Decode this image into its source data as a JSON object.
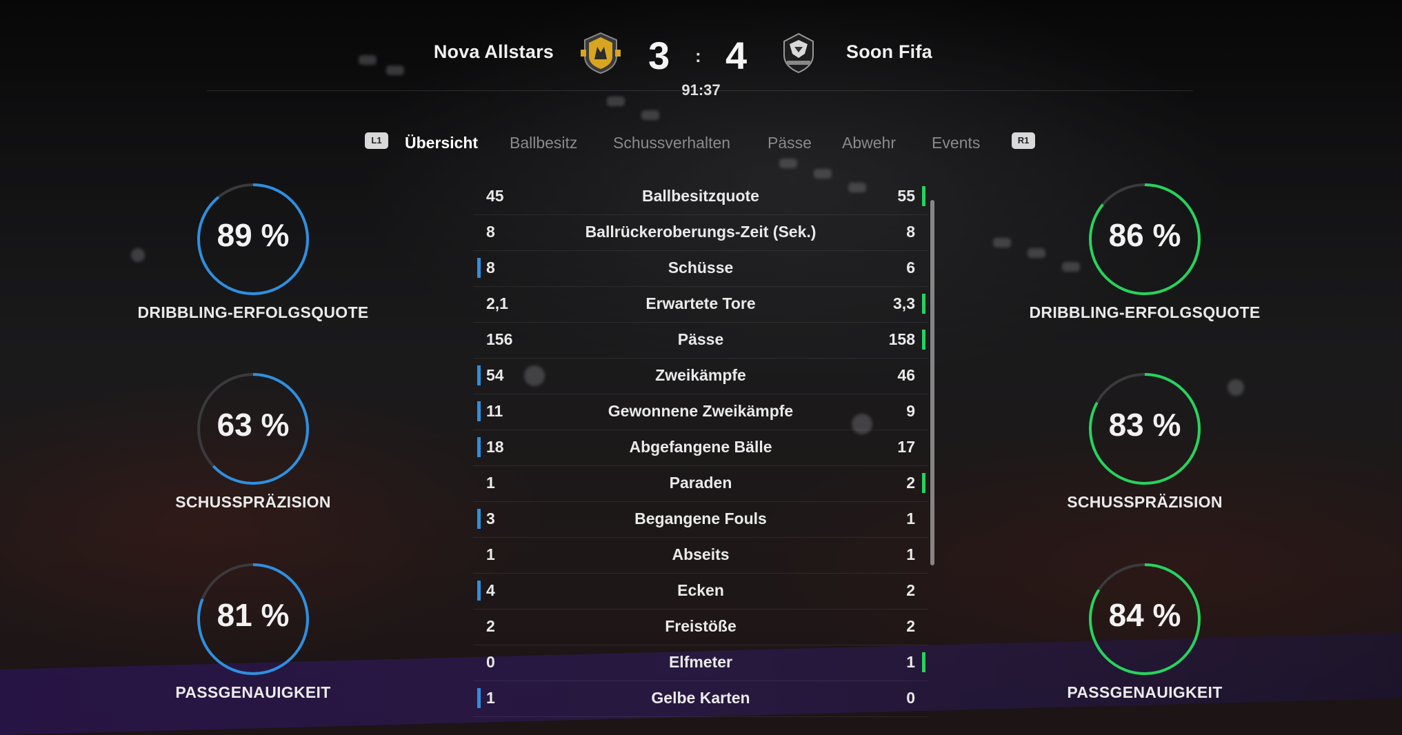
{
  "match": {
    "home_team": "Nova Allstars",
    "away_team": "Soon Fifa",
    "home_score": "3",
    "away_score": "4",
    "score_separator": ":",
    "clock": "91:37"
  },
  "tabs": {
    "left_shoulder": "L1",
    "right_shoulder": "R1",
    "items": [
      {
        "label": "Übersicht",
        "active": true
      },
      {
        "label": "Ballbesitz",
        "active": false
      },
      {
        "label": "Schussverhalten",
        "active": false
      },
      {
        "label": "Pässe",
        "active": false
      },
      {
        "label": "Abwehr",
        "active": false
      },
      {
        "label": "Events",
        "active": false
      }
    ]
  },
  "colors": {
    "home_accent": "#2f8fe0",
    "away_accent": "#27d35d",
    "gauge_track": "#3a3a3c"
  },
  "stats": [
    {
      "home": "45",
      "label": "Ballbesitzquote",
      "away": "55",
      "leader": "away"
    },
    {
      "home": "8",
      "label": "Ballrückeroberungs-Zeit (Sek.)",
      "away": "8",
      "leader": "none"
    },
    {
      "home": "8",
      "label": "Schüsse",
      "away": "6",
      "leader": "home"
    },
    {
      "home": "2,1",
      "label": "Erwartete Tore",
      "away": "3,3",
      "leader": "away"
    },
    {
      "home": "156",
      "label": "Pässe",
      "away": "158",
      "leader": "away"
    },
    {
      "home": "54",
      "label": "Zweikämpfe",
      "away": "46",
      "leader": "home"
    },
    {
      "home": "11",
      "label": "Gewonnene Zweikämpfe",
      "away": "9",
      "leader": "home"
    },
    {
      "home": "18",
      "label": "Abgefangene Bälle",
      "away": "17",
      "leader": "home"
    },
    {
      "home": "1",
      "label": "Paraden",
      "away": "2",
      "leader": "away"
    },
    {
      "home": "3",
      "label": "Begangene Fouls",
      "away": "1",
      "leader": "home"
    },
    {
      "home": "1",
      "label": "Abseits",
      "away": "1",
      "leader": "none"
    },
    {
      "home": "4",
      "label": "Ecken",
      "away": "2",
      "leader": "home"
    },
    {
      "home": "2",
      "label": "Freistöße",
      "away": "2",
      "leader": "none"
    },
    {
      "home": "0",
      "label": "Elfmeter",
      "away": "1",
      "leader": "away"
    },
    {
      "home": "1",
      "label": "Gelbe Karten",
      "away": "0",
      "leader": "home"
    }
  ],
  "gauges": {
    "home": [
      {
        "value_text": "89 %",
        "percent": 89,
        "label": "DRIBBLING-ERFOLGSQUOTE"
      },
      {
        "value_text": "63 %",
        "percent": 63,
        "label": "SCHUSSPRÄZISION"
      },
      {
        "value_text": "81 %",
        "percent": 81,
        "label": "PASSGENAUIGKEIT"
      }
    ],
    "away": [
      {
        "value_text": "86 %",
        "percent": 86,
        "label": "DRIBBLING-ERFOLGSQUOTE"
      },
      {
        "value_text": "83 %",
        "percent": 83,
        "label": "SCHUSSPRÄZISION"
      },
      {
        "value_text": "84 %",
        "percent": 84,
        "label": "PASSGENAUIGKEIT"
      }
    ]
  }
}
